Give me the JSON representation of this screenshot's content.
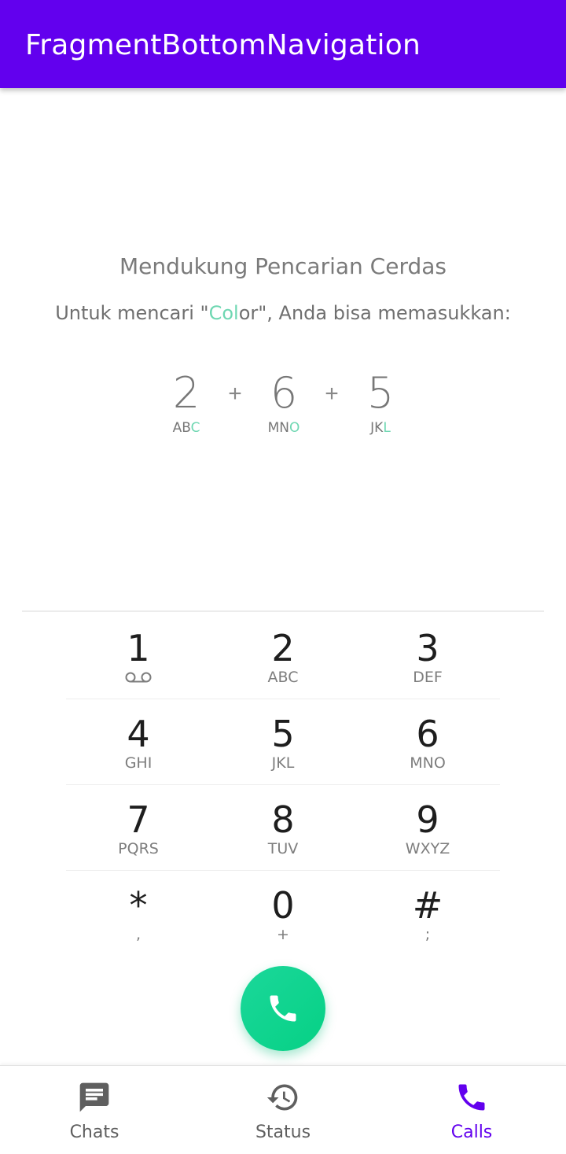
{
  "app": {
    "title": "FragmentBottomNavigation"
  },
  "hint": {
    "title": "Mendukung Pencarian Cerdas",
    "sub_prefix": "Untuk mencari \"",
    "sub_highlight": "Col",
    "sub_rest": "or\", Anda bisa memasukkan:",
    "plus": "+",
    "example": [
      {
        "digit": "2",
        "letters_plain": "AB",
        "letters_hl": "C"
      },
      {
        "digit": "6",
        "letters_plain": "MN",
        "letters_hl": "O"
      },
      {
        "digit": "5",
        "letters_plain": "JK",
        "letters_hl": "L"
      }
    ]
  },
  "dialpad": {
    "keys": [
      {
        "digit": "1",
        "letters": "",
        "icon": "voicemail-icon"
      },
      {
        "digit": "2",
        "letters": "ABC"
      },
      {
        "digit": "3",
        "letters": "DEF"
      },
      {
        "digit": "4",
        "letters": "GHI"
      },
      {
        "digit": "5",
        "letters": "JKL"
      },
      {
        "digit": "6",
        "letters": "MNO"
      },
      {
        "digit": "7",
        "letters": "PQRS"
      },
      {
        "digit": "8",
        "letters": "TUV"
      },
      {
        "digit": "9",
        "letters": "WXYZ"
      },
      {
        "digit": "*",
        "letters": ","
      },
      {
        "digit": "0",
        "letters": "+"
      },
      {
        "digit": "#",
        "letters": ";"
      }
    ]
  },
  "call_button": {
    "icon": "phone-icon"
  },
  "bottom_nav": {
    "items": [
      {
        "label": "Chats",
        "icon": "chat-icon",
        "active": false
      },
      {
        "label": "Status",
        "icon": "history-icon",
        "active": false
      },
      {
        "label": "Calls",
        "icon": "phone-icon",
        "active": true
      }
    ]
  },
  "colors": {
    "primary": "#6200EE",
    "accent_green": "#06D185",
    "highlight": "#6FD7B2"
  }
}
